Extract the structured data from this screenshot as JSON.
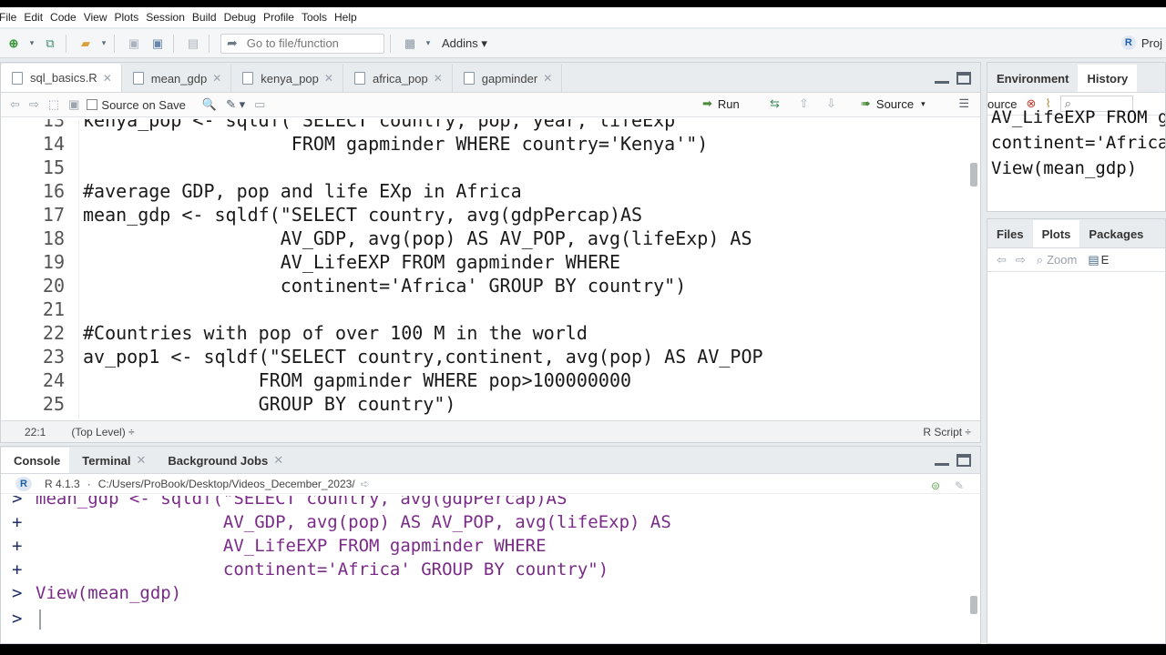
{
  "menu": [
    "File",
    "Edit",
    "Code",
    "View",
    "Plots",
    "Session",
    "Build",
    "Debug",
    "Profile",
    "Tools",
    "Help"
  ],
  "toolbar": {
    "goto_placeholder": "Go to file/function",
    "addins_label": "Addins",
    "project_label": "Proj"
  },
  "source": {
    "tabs": [
      {
        "label": "sql_basics.R",
        "active": true
      },
      {
        "label": "mean_gdp",
        "active": false
      },
      {
        "label": "kenya_pop",
        "active": false
      },
      {
        "label": "africa_pop",
        "active": false
      },
      {
        "label": "gapminder",
        "active": false
      }
    ],
    "source_on_save": "Source on Save",
    "run_label": "Run",
    "source_label": "Source",
    "lines": [
      {
        "num": "13",
        "text": "kenya_pop <- sqldf(\"SELECT country, pop, year, lifeExp",
        "type": "code"
      },
      {
        "num": "14",
        "text": "                   FROM gapminder WHERE country='Kenya'\")",
        "type": "code"
      },
      {
        "num": "15",
        "text": "",
        "type": "code"
      },
      {
        "num": "16",
        "text": "#average GDP, pop and life EXp in Africa",
        "type": "comment"
      },
      {
        "num": "17",
        "text": "mean_gdp <- sqldf(\"SELECT country, avg(gdpPercap)AS",
        "type": "code"
      },
      {
        "num": "18",
        "text": "                  AV_GDP, avg(pop) AS AV_POP, avg(lifeExp) AS",
        "type": "code"
      },
      {
        "num": "19",
        "text": "                  AV_LifeEXP FROM gapminder WHERE",
        "type": "code"
      },
      {
        "num": "20",
        "text": "                  continent='Africa' GROUP BY country\")",
        "type": "code"
      },
      {
        "num": "21",
        "text": "",
        "type": "code"
      },
      {
        "num": "22",
        "text": "#Countries with pop of over 100 M in the world",
        "type": "comment"
      },
      {
        "num": "23",
        "text": "av_pop1 <- sqldf(\"SELECT country,continent, avg(pop) AS AV_POP",
        "type": "code"
      },
      {
        "num": "24",
        "text": "                FROM gapminder WHERE pop>100000000",
        "type": "code"
      },
      {
        "num": "25",
        "text": "                GROUP BY country\")",
        "type": "code"
      }
    ],
    "status_position": "22:1",
    "status_scope": "(Top Level) ÷",
    "status_filetype": "R Script ÷"
  },
  "console": {
    "tabs": [
      {
        "label": "Console",
        "active": true,
        "closable": false
      },
      {
        "label": "Terminal",
        "active": false,
        "closable": true
      },
      {
        "label": "Background Jobs",
        "active": false,
        "closable": true
      }
    ],
    "r_version": "R 4.1.3",
    "path": "C:/Users/ProBook/Desktop/Videos_December_2023/",
    "lines": [
      {
        "prompt": ">",
        "text": "mean_gdp <- sqldf(\"SELECT country, avg(gdpPercap)AS"
      },
      {
        "prompt": "+",
        "text": "                  AV_GDP, avg(pop) AS AV_POP, avg(lifeExp) AS"
      },
      {
        "prompt": "+",
        "text": "                  AV_LifeEXP FROM gapminder WHERE"
      },
      {
        "prompt": "+",
        "text": "                  continent='Africa' GROUP BY country\")"
      },
      {
        "prompt": ">",
        "text": "View(mean_gdp)"
      },
      {
        "prompt": ">",
        "text": ""
      }
    ]
  },
  "env": {
    "tabs": [
      {
        "label": "Environment",
        "active": false
      },
      {
        "label": "History",
        "active": true
      }
    ],
    "to_source": "ource",
    "history_lines": [
      "AV_LifeEXP FROM gapminder WHERE",
      "continent='Africa' GROUP BY country\")",
      "View(mean_gdp)"
    ]
  },
  "files": {
    "tabs": [
      {
        "label": "Files",
        "active": false
      },
      {
        "label": "Plots",
        "active": true
      },
      {
        "label": "Packages",
        "active": false
      }
    ],
    "zoom_label": "Zoom",
    "export_label": "E"
  }
}
